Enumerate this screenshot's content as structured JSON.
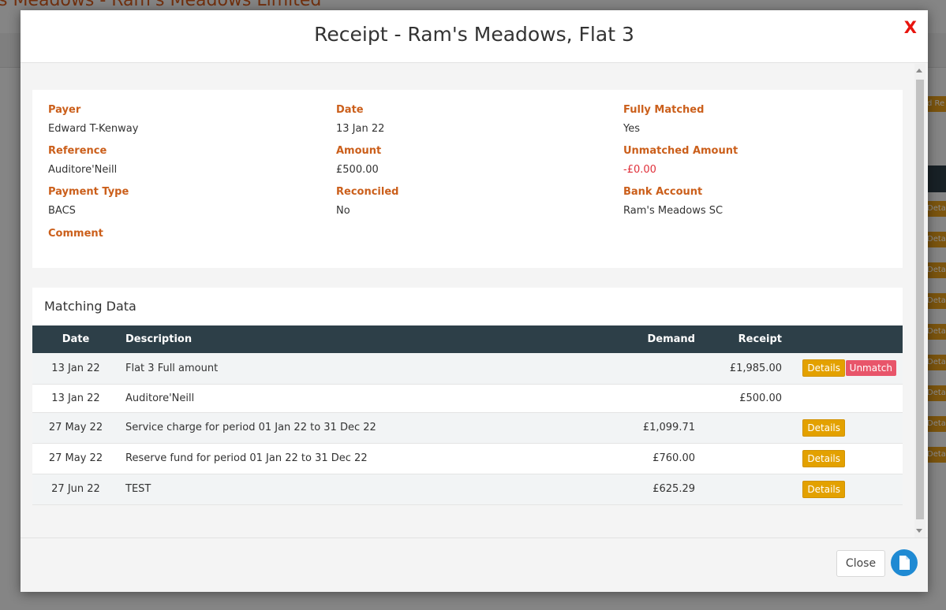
{
  "background": {
    "page_title": "s Meadows - Ram's Meadows Limited",
    "side_button_labels": [
      "d Re",
      "Deta",
      "Deta",
      "Deta",
      "Deta",
      "Deta",
      "Deta",
      "Deta",
      "Deta",
      "Deta"
    ]
  },
  "modal": {
    "title": "Receipt - Ram's Meadows, Flat 3",
    "close_x": "X"
  },
  "info": {
    "payer_label": "Payer",
    "payer": "Edward T-Kenway",
    "date_label": "Date",
    "date": "13 Jan 22",
    "fully_matched_label": "Fully Matched",
    "fully_matched": "Yes",
    "reference_label": "Reference",
    "reference": "Auditore'Neill",
    "amount_label": "Amount",
    "amount": "£500.00",
    "unmatched_amount_label": "Unmatched Amount",
    "unmatched_amount": "-£0.00",
    "payment_type_label": "Payment Type",
    "payment_type": "BACS",
    "reconciled_label": "Reconciled",
    "reconciled": "No",
    "bank_account_label": "Bank Account",
    "bank_account": "Ram's Meadows SC",
    "comment_label": "Comment"
  },
  "matching": {
    "title": "Matching Data",
    "columns": {
      "date": "Date",
      "description": "Description",
      "demand": "Demand",
      "receipt": "Receipt"
    },
    "rows": [
      {
        "date": "13 Jan 22",
        "description": "Flat 3 Full amount",
        "demand": "",
        "receipt": "£1,985.00",
        "details": "Details",
        "unmatch": "Unmatch"
      },
      {
        "date": "13 Jan 22",
        "description": "Auditore'Neill",
        "demand": "",
        "receipt": "£500.00"
      },
      {
        "date": "27 May 22",
        "description": "Service charge for period 01 Jan 22 to 31 Dec 22",
        "demand": "£1,099.71",
        "receipt": "",
        "details": "Details"
      },
      {
        "date": "27 May 22",
        "description": "Reserve fund for period 01 Jan 22 to 31 Dec 22",
        "demand": "£760.00",
        "receipt": "",
        "details": "Details"
      },
      {
        "date": "27 Jun 22",
        "description": "TEST",
        "demand": "£625.29",
        "receipt": "",
        "details": "Details"
      }
    ]
  },
  "footer": {
    "close_label": "Close",
    "doc_icon": "document-icon"
  },
  "colors": {
    "accent_orange": "#cb5f1b",
    "table_header": "#2d3f48",
    "details_button": "#e3a100",
    "unmatch_button": "#e8556a",
    "close_x": "#e8140e",
    "doc_button": "#1f8ad3",
    "negative": "#e0303a"
  }
}
